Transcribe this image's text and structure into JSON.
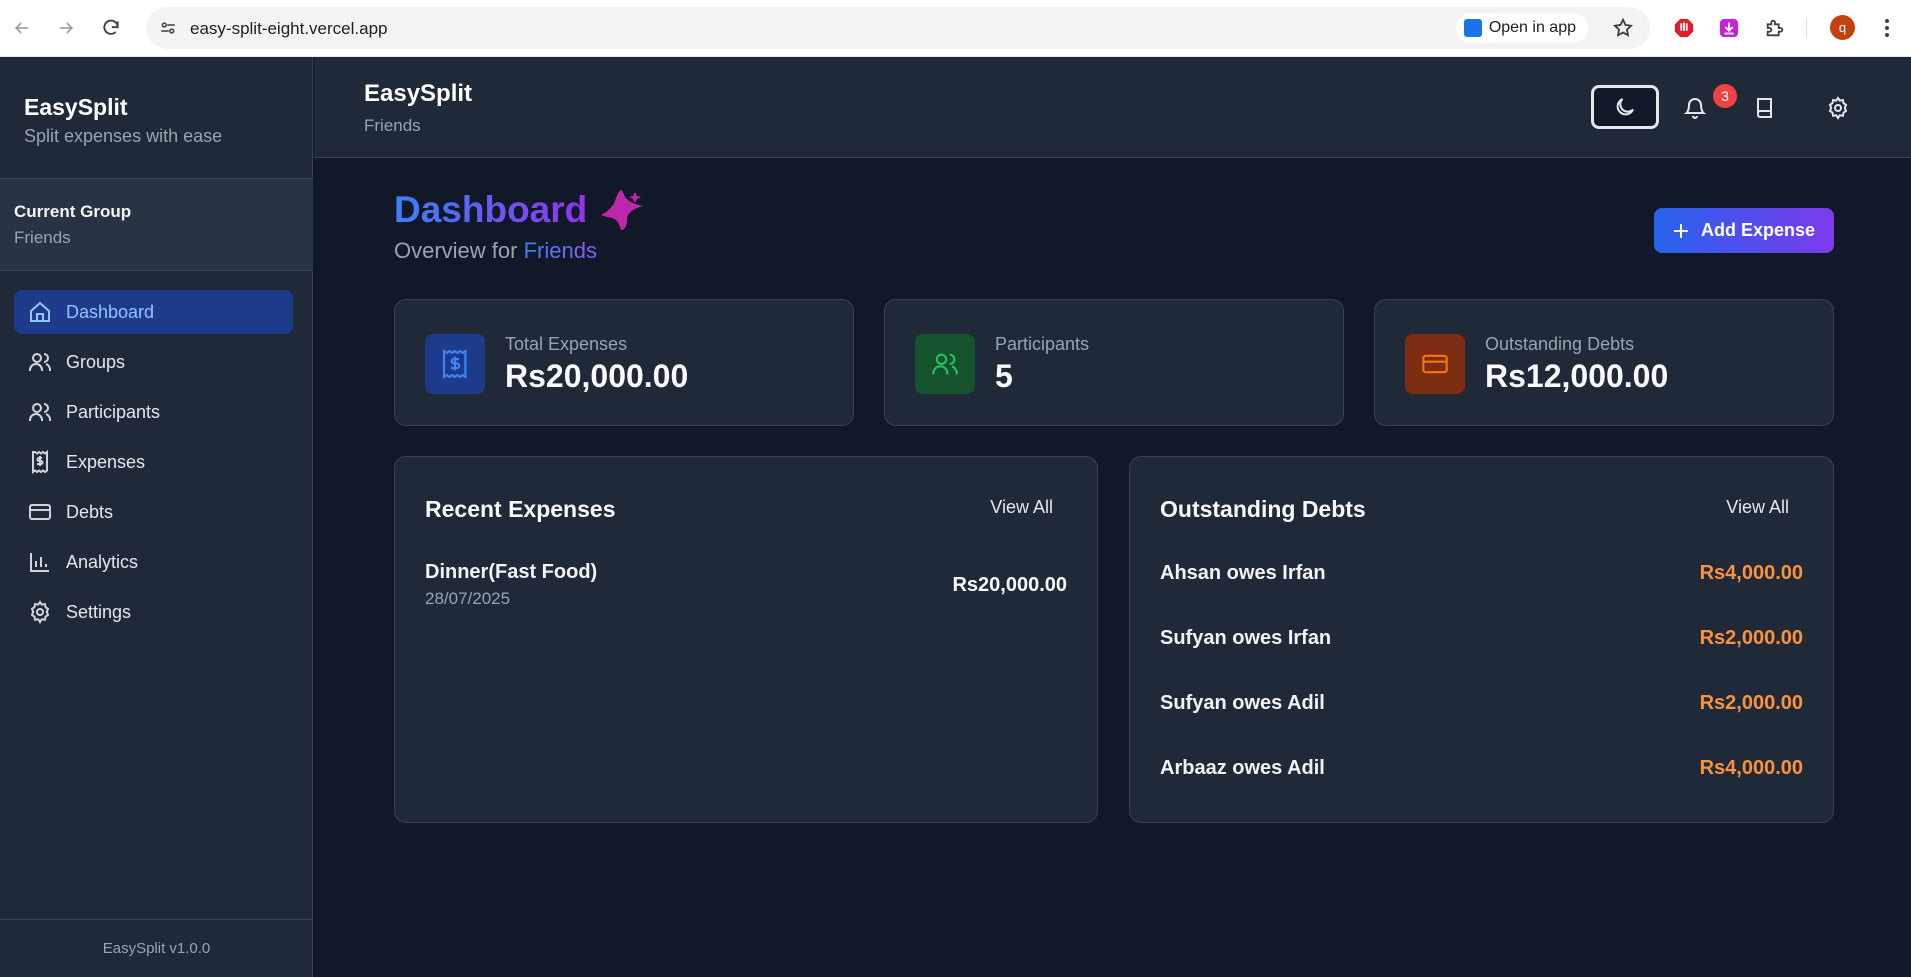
{
  "browser": {
    "url": "easy-split-eight.vercel.app",
    "open_in_app": "Open in app",
    "profile_initial": "q"
  },
  "sidebar": {
    "title": "EasySplit",
    "subtitle": "Split expenses with ease",
    "current_group_label": "Current Group",
    "current_group": "Friends",
    "items": [
      {
        "label": "Dashboard",
        "icon": "home-icon",
        "active": true
      },
      {
        "label": "Groups",
        "icon": "users-icon"
      },
      {
        "label": "Participants",
        "icon": "users-icon"
      },
      {
        "label": "Expenses",
        "icon": "receipt-icon"
      },
      {
        "label": "Debts",
        "icon": "credit-card-icon"
      },
      {
        "label": "Analytics",
        "icon": "bar-chart-icon"
      },
      {
        "label": "Settings",
        "icon": "gear-icon"
      }
    ],
    "version": "EasySplit v1.0.0"
  },
  "header": {
    "title": "EasySplit",
    "subtitle": "Friends",
    "notification_count": "3"
  },
  "main": {
    "title": "Dashboard",
    "overview_prefix": "Overview for",
    "overview_group": "Friends",
    "add_expense": "Add Expense",
    "stats": [
      {
        "label": "Total Expenses",
        "value": "Rs20,000.00",
        "icon": "dollar-receipt-icon",
        "color": "#3b82f6"
      },
      {
        "label": "Participants",
        "value": "5",
        "icon": "users-icon",
        "color": "#22c55e"
      },
      {
        "label": "Outstanding Debts",
        "value": "Rs12,000.00",
        "icon": "credit-card-icon",
        "color": "#f97316"
      }
    ],
    "recent_expenses": {
      "title": "Recent Expenses",
      "view_all": "View All",
      "items": [
        {
          "name": "Dinner(Fast Food)",
          "date": "28/07/2025",
          "amount": "Rs20,000.00"
        }
      ]
    },
    "outstanding_debts": {
      "title": "Outstanding Debts",
      "view_all": "View All",
      "items": [
        {
          "text": "Ahsan owes Irfan",
          "amount": "Rs4,000.00"
        },
        {
          "text": "Sufyan owes Irfan",
          "amount": "Rs2,000.00"
        },
        {
          "text": "Sufyan owes Adil",
          "amount": "Rs2,000.00"
        },
        {
          "text": "Arbaaz owes Adil",
          "amount": "Rs4,000.00"
        }
      ]
    }
  }
}
